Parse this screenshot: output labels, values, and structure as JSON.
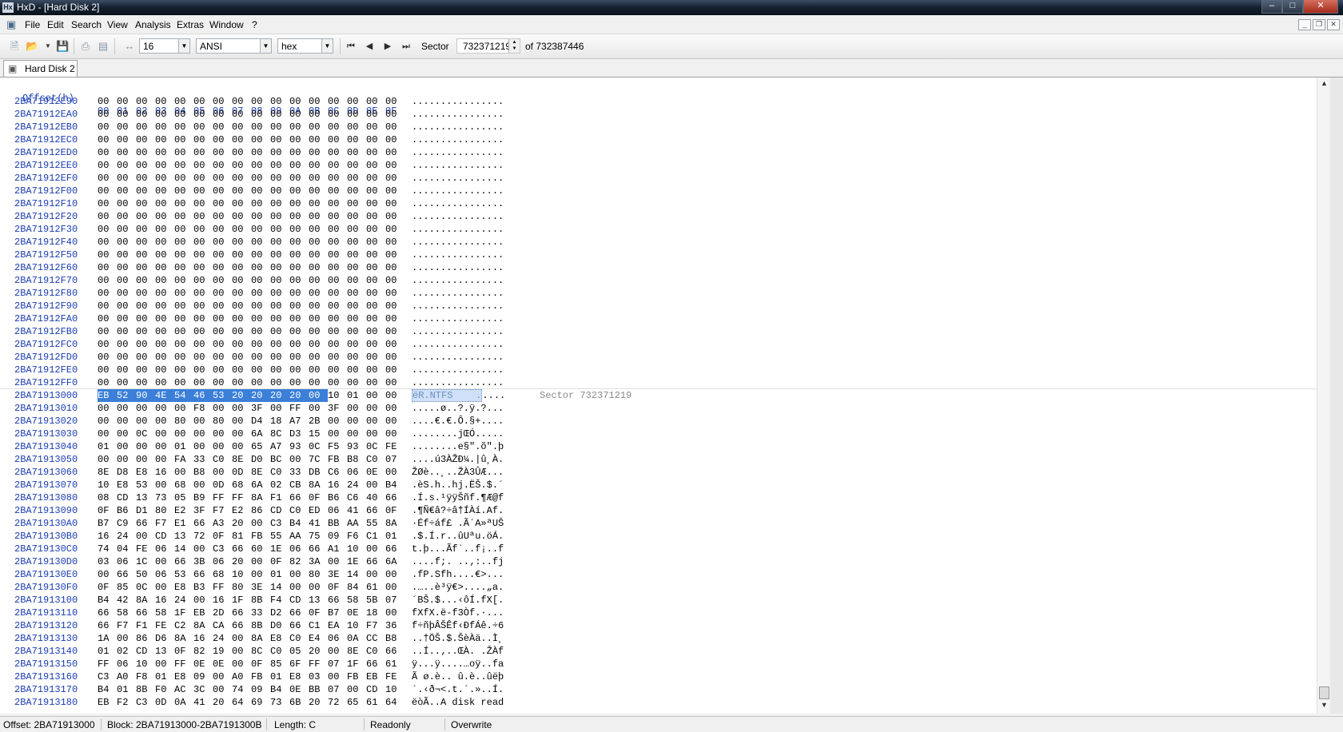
{
  "window": {
    "title": "HxD - [Hard Disk 2]",
    "app_icon_text": "Hx"
  },
  "menu": [
    "File",
    "Edit",
    "Search",
    "View",
    "Analysis",
    "Extras",
    "Window",
    "?"
  ],
  "toolbar": {
    "bytes_per_row": "16",
    "charset": "ANSI",
    "offset_base": "hex",
    "sector_label": "Sector",
    "sector_value": "732371219",
    "sector_total": "of 732387446"
  },
  "tab": {
    "label": "Hard Disk 2"
  },
  "editor": {
    "header": {
      "offset": "Offset(h)",
      "columns": [
        "00",
        "01",
        "02",
        "03",
        "04",
        "05",
        "06",
        "07",
        "08",
        "09",
        "0A",
        "0B",
        "0C",
        "0D",
        "0E",
        "0F"
      ]
    },
    "sector_annotation": "Sector 732371219",
    "rows": [
      {
        "offset": "2BA71912E90",
        "hex": "00 00 00 00 00 00 00 00 00 00 00 00 00 00 00 00",
        "ascii": "................"
      },
      {
        "offset": "2BA71912EA0",
        "hex": "00 00 00 00 00 00 00 00 00 00 00 00 00 00 00 00",
        "ascii": "................"
      },
      {
        "offset": "2BA71912EB0",
        "hex": "00 00 00 00 00 00 00 00 00 00 00 00 00 00 00 00",
        "ascii": "................"
      },
      {
        "offset": "2BA71912EC0",
        "hex": "00 00 00 00 00 00 00 00 00 00 00 00 00 00 00 00",
        "ascii": "................"
      },
      {
        "offset": "2BA71912ED0",
        "hex": "00 00 00 00 00 00 00 00 00 00 00 00 00 00 00 00",
        "ascii": "................"
      },
      {
        "offset": "2BA71912EE0",
        "hex": "00 00 00 00 00 00 00 00 00 00 00 00 00 00 00 00",
        "ascii": "................"
      },
      {
        "offset": "2BA71912EF0",
        "hex": "00 00 00 00 00 00 00 00 00 00 00 00 00 00 00 00",
        "ascii": "................"
      },
      {
        "offset": "2BA71912F00",
        "hex": "00 00 00 00 00 00 00 00 00 00 00 00 00 00 00 00",
        "ascii": "................"
      },
      {
        "offset": "2BA71912F10",
        "hex": "00 00 00 00 00 00 00 00 00 00 00 00 00 00 00 00",
        "ascii": "................"
      },
      {
        "offset": "2BA71912F20",
        "hex": "00 00 00 00 00 00 00 00 00 00 00 00 00 00 00 00",
        "ascii": "................"
      },
      {
        "offset": "2BA71912F30",
        "hex": "00 00 00 00 00 00 00 00 00 00 00 00 00 00 00 00",
        "ascii": "................"
      },
      {
        "offset": "2BA71912F40",
        "hex": "00 00 00 00 00 00 00 00 00 00 00 00 00 00 00 00",
        "ascii": "................"
      },
      {
        "offset": "2BA71912F50",
        "hex": "00 00 00 00 00 00 00 00 00 00 00 00 00 00 00 00",
        "ascii": "................"
      },
      {
        "offset": "2BA71912F60",
        "hex": "00 00 00 00 00 00 00 00 00 00 00 00 00 00 00 00",
        "ascii": "................"
      },
      {
        "offset": "2BA71912F70",
        "hex": "00 00 00 00 00 00 00 00 00 00 00 00 00 00 00 00",
        "ascii": "................"
      },
      {
        "offset": "2BA71912F80",
        "hex": "00 00 00 00 00 00 00 00 00 00 00 00 00 00 00 00",
        "ascii": "................"
      },
      {
        "offset": "2BA71912F90",
        "hex": "00 00 00 00 00 00 00 00 00 00 00 00 00 00 00 00",
        "ascii": "................"
      },
      {
        "offset": "2BA71912FA0",
        "hex": "00 00 00 00 00 00 00 00 00 00 00 00 00 00 00 00",
        "ascii": "................"
      },
      {
        "offset": "2BA71912FB0",
        "hex": "00 00 00 00 00 00 00 00 00 00 00 00 00 00 00 00",
        "ascii": "................"
      },
      {
        "offset": "2BA71912FC0",
        "hex": "00 00 00 00 00 00 00 00 00 00 00 00 00 00 00 00",
        "ascii": "................"
      },
      {
        "offset": "2BA71912FD0",
        "hex": "00 00 00 00 00 00 00 00 00 00 00 00 00 00 00 00",
        "ascii": "................"
      },
      {
        "offset": "2BA71912FE0",
        "hex": "00 00 00 00 00 00 00 00 00 00 00 00 00 00 00 00",
        "ascii": "................"
      },
      {
        "offset": "2BA71912FF0",
        "hex": "00 00 00 00 00 00 00 00 00 00 00 00 00 00 00 00",
        "ascii": "................"
      },
      {
        "offset": "2BA71913000",
        "hex": "EB 52 90 4E 54 46 53 20 20 20 20 00 10 01 00 00",
        "ascii": "ëR.NTFS    .....",
        "selected_bytes": 12,
        "sector_start": true
      },
      {
        "offset": "2BA71913010",
        "hex": "00 00 00 00 00 F8 00 00 3F 00 FF 00 3F 00 00 00",
        "ascii": ".....ø..?.ÿ.?..."
      },
      {
        "offset": "2BA71913020",
        "hex": "00 00 00 00 80 00 80 00 D4 18 A7 2B 00 00 00 00",
        "ascii": "....€.€.Ô.§+...."
      },
      {
        "offset": "2BA71913030",
        "hex": "00 00 0C 00 00 00 00 00 6A 8C D3 15 00 00 00 00",
        "ascii": "........jŒÓ....."
      },
      {
        "offset": "2BA71913040",
        "hex": "01 00 00 00 01 00 00 00 65 A7 93 0C F5 93 0C FE",
        "ascii": "........e§\".õ\".þ"
      },
      {
        "offset": "2BA71913050",
        "hex": "00 00 00 00 FA 33 C0 8E D0 BC 00 7C FB B8 C0 07",
        "ascii": "....ú3ÀŽÐ¼.|û¸À."
      },
      {
        "offset": "2BA71913060",
        "hex": "8E D8 E8 16 00 B8 00 0D 8E C0 33 DB C6 06 0E 00",
        "ascii": "ŽØè..¸..ŽÀ3ÛÆ..."
      },
      {
        "offset": "2BA71913070",
        "hex": "10 E8 53 00 68 00 0D 68 6A 02 CB 8A 16 24 00 B4",
        "ascii": ".èS.h..hj.ËŠ.$.´"
      },
      {
        "offset": "2BA71913080",
        "hex": "08 CD 13 73 05 B9 FF FF 8A F1 66 0F B6 C6 40 66",
        "ascii": ".Í.s.¹ÿÿŠñf.¶Æ@f"
      },
      {
        "offset": "2BA71913090",
        "hex": "0F B6 D1 80 E2 3F F7 E2 86 CD C0 ED 06 41 66 0F",
        "ascii": ".¶Ñ€â?÷â†ÍÀí.Af."
      },
      {
        "offset": "2BA719130A0",
        "hex": "B7 C9 66 F7 E1 66 A3 20 00 C3 B4 41 BB AA 55 8A",
        "ascii": "·Éf÷áf£ .Ã´A»ªUŠ"
      },
      {
        "offset": "2BA719130B0",
        "hex": "16 24 00 CD 13 72 0F 81 FB 55 AA 75 09 F6 C1 01",
        "ascii": ".$.Í.r..ûUªu.öÁ."
      },
      {
        "offset": "2BA719130C0",
        "hex": "74 04 FE 06 14 00 C3 66 60 1E 06 66 A1 10 00 66",
        "ascii": "t.þ...Ãf`..f¡..f"
      },
      {
        "offset": "2BA719130D0",
        "hex": "03 06 1C 00 66 3B 06 20 00 0F 82 3A 00 1E 66 6A",
        "ascii": "....f;. ..‚:..fj"
      },
      {
        "offset": "2BA719130E0",
        "hex": "00 66 50 06 53 66 68 10 00 01 00 80 3E 14 00 00",
        "ascii": ".fP.Sfh....€>..."
      },
      {
        "offset": "2BA719130F0",
        "hex": "0F 85 0C 00 E8 B3 FF 80 3E 14 00 00 0F 84 61 00",
        "ascii": ".…..è³ÿ€>....„a."
      },
      {
        "offset": "2BA71913100",
        "hex": "B4 42 8A 16 24 00 16 1F 8B F4 CD 13 66 58 5B 07",
        "ascii": "´BŠ.$...‹ôÍ.fX[."
      },
      {
        "offset": "2BA71913110",
        "hex": "66 58 66 58 1F EB 2D 66 33 D2 66 0F B7 0E 18 00",
        "ascii": "fXfX.ë-f3Òf.·..."
      },
      {
        "offset": "2BA71913120",
        "hex": "66 F7 F1 FE C2 8A CA 66 8B D0 66 C1 EA 10 F7 36",
        "ascii": "f÷ñþÂŠÊf‹ÐfÁê.÷6"
      },
      {
        "offset": "2BA71913130",
        "hex": "1A 00 86 D6 8A 16 24 00 8A E8 C0 E4 06 0A CC B8",
        "ascii": "..†ÖŠ.$.ŠèÀä..Ì¸"
      },
      {
        "offset": "2BA71913140",
        "hex": "01 02 CD 13 0F 82 19 00 8C C0 05 20 00 8E C0 66",
        "ascii": "..Í..‚..ŒÀ. .ŽÀf"
      },
      {
        "offset": "2BA71913150",
        "hex": "FF 06 10 00 FF 0E 0E 00 0F 85 6F FF 07 1F 66 61",
        "ascii": "ÿ...ÿ....…oÿ..fa"
      },
      {
        "offset": "2BA71913160",
        "hex": "C3 A0 F8 01 E8 09 00 A0 FB 01 E8 03 00 FB EB FE",
        "ascii": "Ã ø.è.. û.è..ûëþ"
      },
      {
        "offset": "2BA71913170",
        "hex": "B4 01 8B F0 AC 3C 00 74 09 B4 0E BB 07 00 CD 10",
        "ascii": "´.‹ð¬<.t.´.»..Í."
      },
      {
        "offset": "2BA71913180",
        "hex": "EB F2 C3 0D 0A 41 20 64 69 73 6B 20 72 65 61 64",
        "ascii": "ëòÃ..A disk read"
      }
    ]
  },
  "status": {
    "offset": "Offset: 2BA71913000",
    "block": "Block: 2BA71913000-2BA7191300B",
    "length": "Length: C",
    "mode": "Readonly",
    "insert_mode": "Overwrite"
  }
}
